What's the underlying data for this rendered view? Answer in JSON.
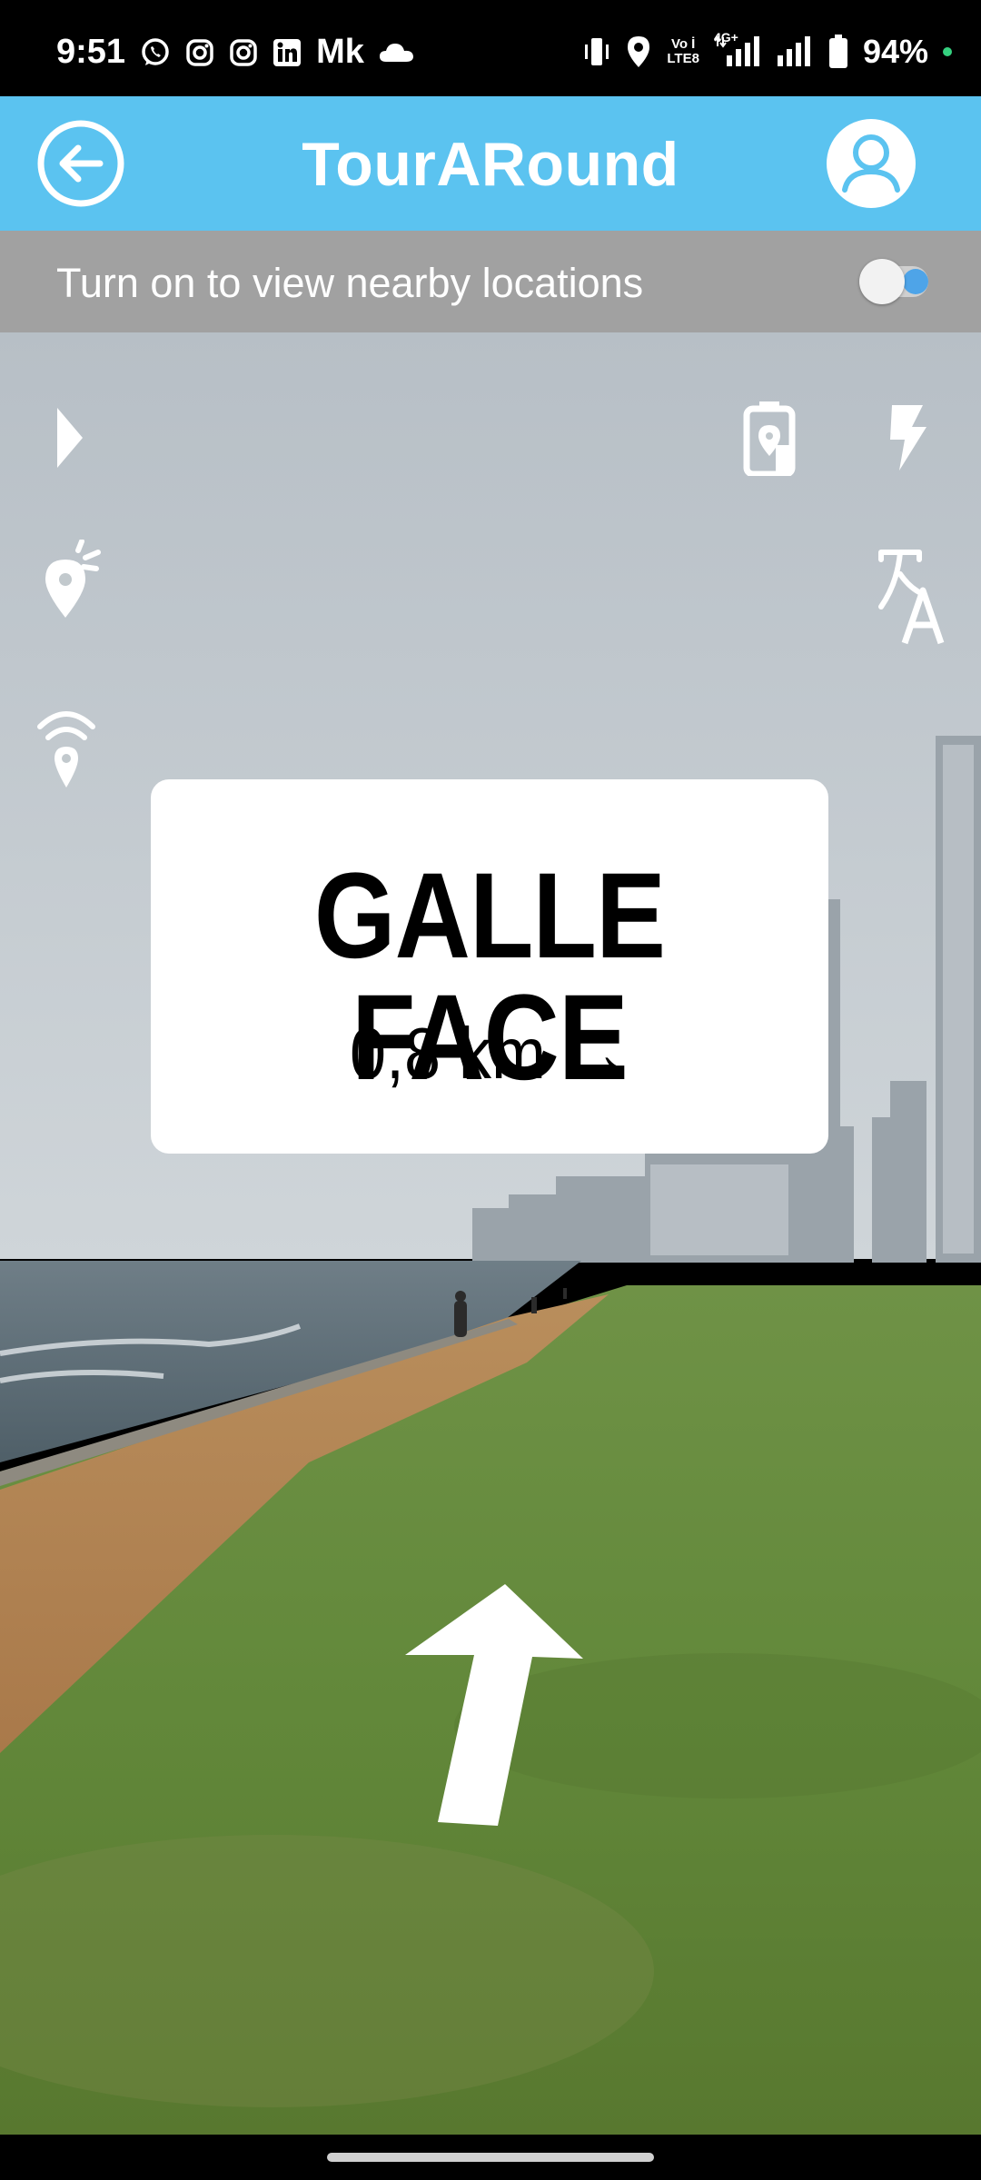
{
  "status_bar": {
    "time": "9:51",
    "left_icons": [
      "whatsapp-icon",
      "instagram-icon",
      "instagram-icon",
      "linkedin-icon",
      "mk-icon",
      "cloud-icon"
    ],
    "mk_label": "Mk",
    "volte_label_top": "Vo İ",
    "volte_label_bottom": "LTE8",
    "network_type": "4G+",
    "battery": "94%",
    "right_icons": [
      "vibrate-icon",
      "location-pin-icon",
      "signal-bars-icon",
      "signal-bars-icon",
      "battery-icon"
    ]
  },
  "header": {
    "title": "TourARound",
    "back_icon": "back-arrow-icon",
    "profile_icon": "user-avatar-icon",
    "bg_color": "#5bc3f0"
  },
  "nearby": {
    "label": "Turn on to view nearby locations",
    "toggle_state": "off"
  },
  "ar_controls": {
    "left": [
      "play-icon",
      "location-marker-icon",
      "broadcast-location-icon"
    ],
    "right": [
      "device-location-icon",
      "flash-icon",
      "translate-icon"
    ]
  },
  "location_card": {
    "name": "GALLE FACE",
    "distance": "0,8 km",
    "arrow": "→"
  },
  "direction_arrow": "direction-arrow-icon"
}
